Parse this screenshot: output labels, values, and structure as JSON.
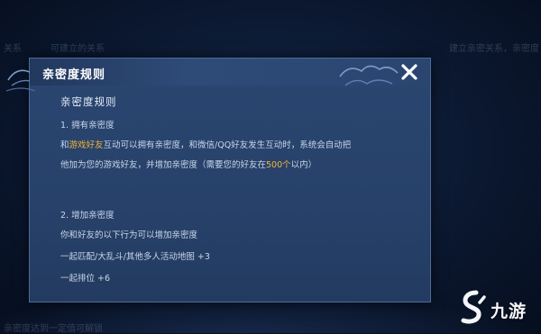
{
  "background": {
    "top_left_text": "关系",
    "top_mid_text": "可建立的关系",
    "top_right_text": "建立亲密关系，亲密度",
    "bottom_text": "亲密度达到一定值可解锁"
  },
  "dialog": {
    "title": "亲密度规则",
    "heading": "亲密度规则",
    "section1_title": "1. 拥有亲密度",
    "s1_line1_a": "和",
    "s1_line1_highlight": "游戏好友",
    "s1_line1_b": "互动可以拥有亲密度，和微信/QQ好友发生互动时，系统会自动把",
    "s1_line2_a": "他加为您的游戏好友，并增加亲密度（需要您的好友在",
    "s1_line2_highlight": "500个",
    "s1_line2_b": "以内）",
    "section2_title": "2. 增加亲密度",
    "s2_line1": "你和好友的以下行为可以增加亲密度",
    "s2_line2": "一起匹配/大乱斗/其他多人活动地图 +3",
    "s2_line3": "一起排位 +6"
  },
  "watermark": {
    "text": "九游"
  },
  "colors": {
    "highlight": "#f2b33b",
    "dialog_bg": "#27416a",
    "page_bg": "#0b1830"
  },
  "icons": {
    "close": "close-x-icon",
    "watermark_logo": "jiuyou-logo-icon"
  }
}
